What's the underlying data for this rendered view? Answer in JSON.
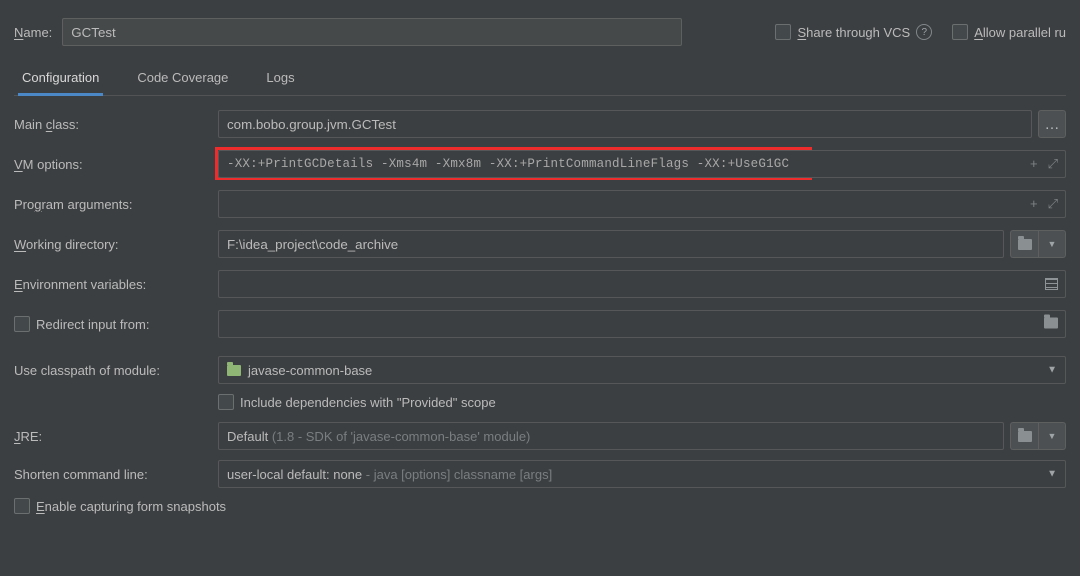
{
  "top": {
    "name_label_pre": "N",
    "name_label_post": "ame:",
    "name_value": "GCTest",
    "share_pre": "S",
    "share_post": "hare through VCS",
    "allow_pre": "A",
    "allow_post": "llow parallel ru"
  },
  "tabs": {
    "config": "Configuration",
    "coverage": "Code Coverage",
    "logs": "Logs"
  },
  "form": {
    "main_class_label_pre": "Main ",
    "main_class_label_u": "c",
    "main_class_label_post": "lass:",
    "main_class_value": "com.bobo.group.jvm.GCTest",
    "vm_label_u": "V",
    "vm_label_post": "M options:",
    "vm_value": "-XX:+PrintGCDetails -Xms4m -Xmx8m -XX:+PrintCommandLineFlags -XX:+UseG1GC",
    "prog_args_pre": "Pro",
    "prog_args_u": "g",
    "prog_args_post": "ram arguments:",
    "workdir_u": "W",
    "workdir_post": "orking directory:",
    "workdir_value": "F:\\idea_project\\code_archive",
    "env_u": "E",
    "env_post": "nvironment variables:",
    "redirect_label": "Redirect input from:",
    "classpath_label": "Use classpath of module:",
    "classpath_value": "javase-common-base",
    "include_provided": "Include dependencies with \"Provided\" scope",
    "jre_u": "J",
    "jre_post": "RE:",
    "jre_value": "Default ",
    "jre_hint": "(1.8 - SDK of 'javase-common-base' module)",
    "shorten_label": "Shorten command line:",
    "shorten_value": "user-local default: none ",
    "shorten_hint": "- java [options] classname [args]",
    "enable_capture_u": "E",
    "enable_capture_post": "nable capturing form snapshots"
  }
}
